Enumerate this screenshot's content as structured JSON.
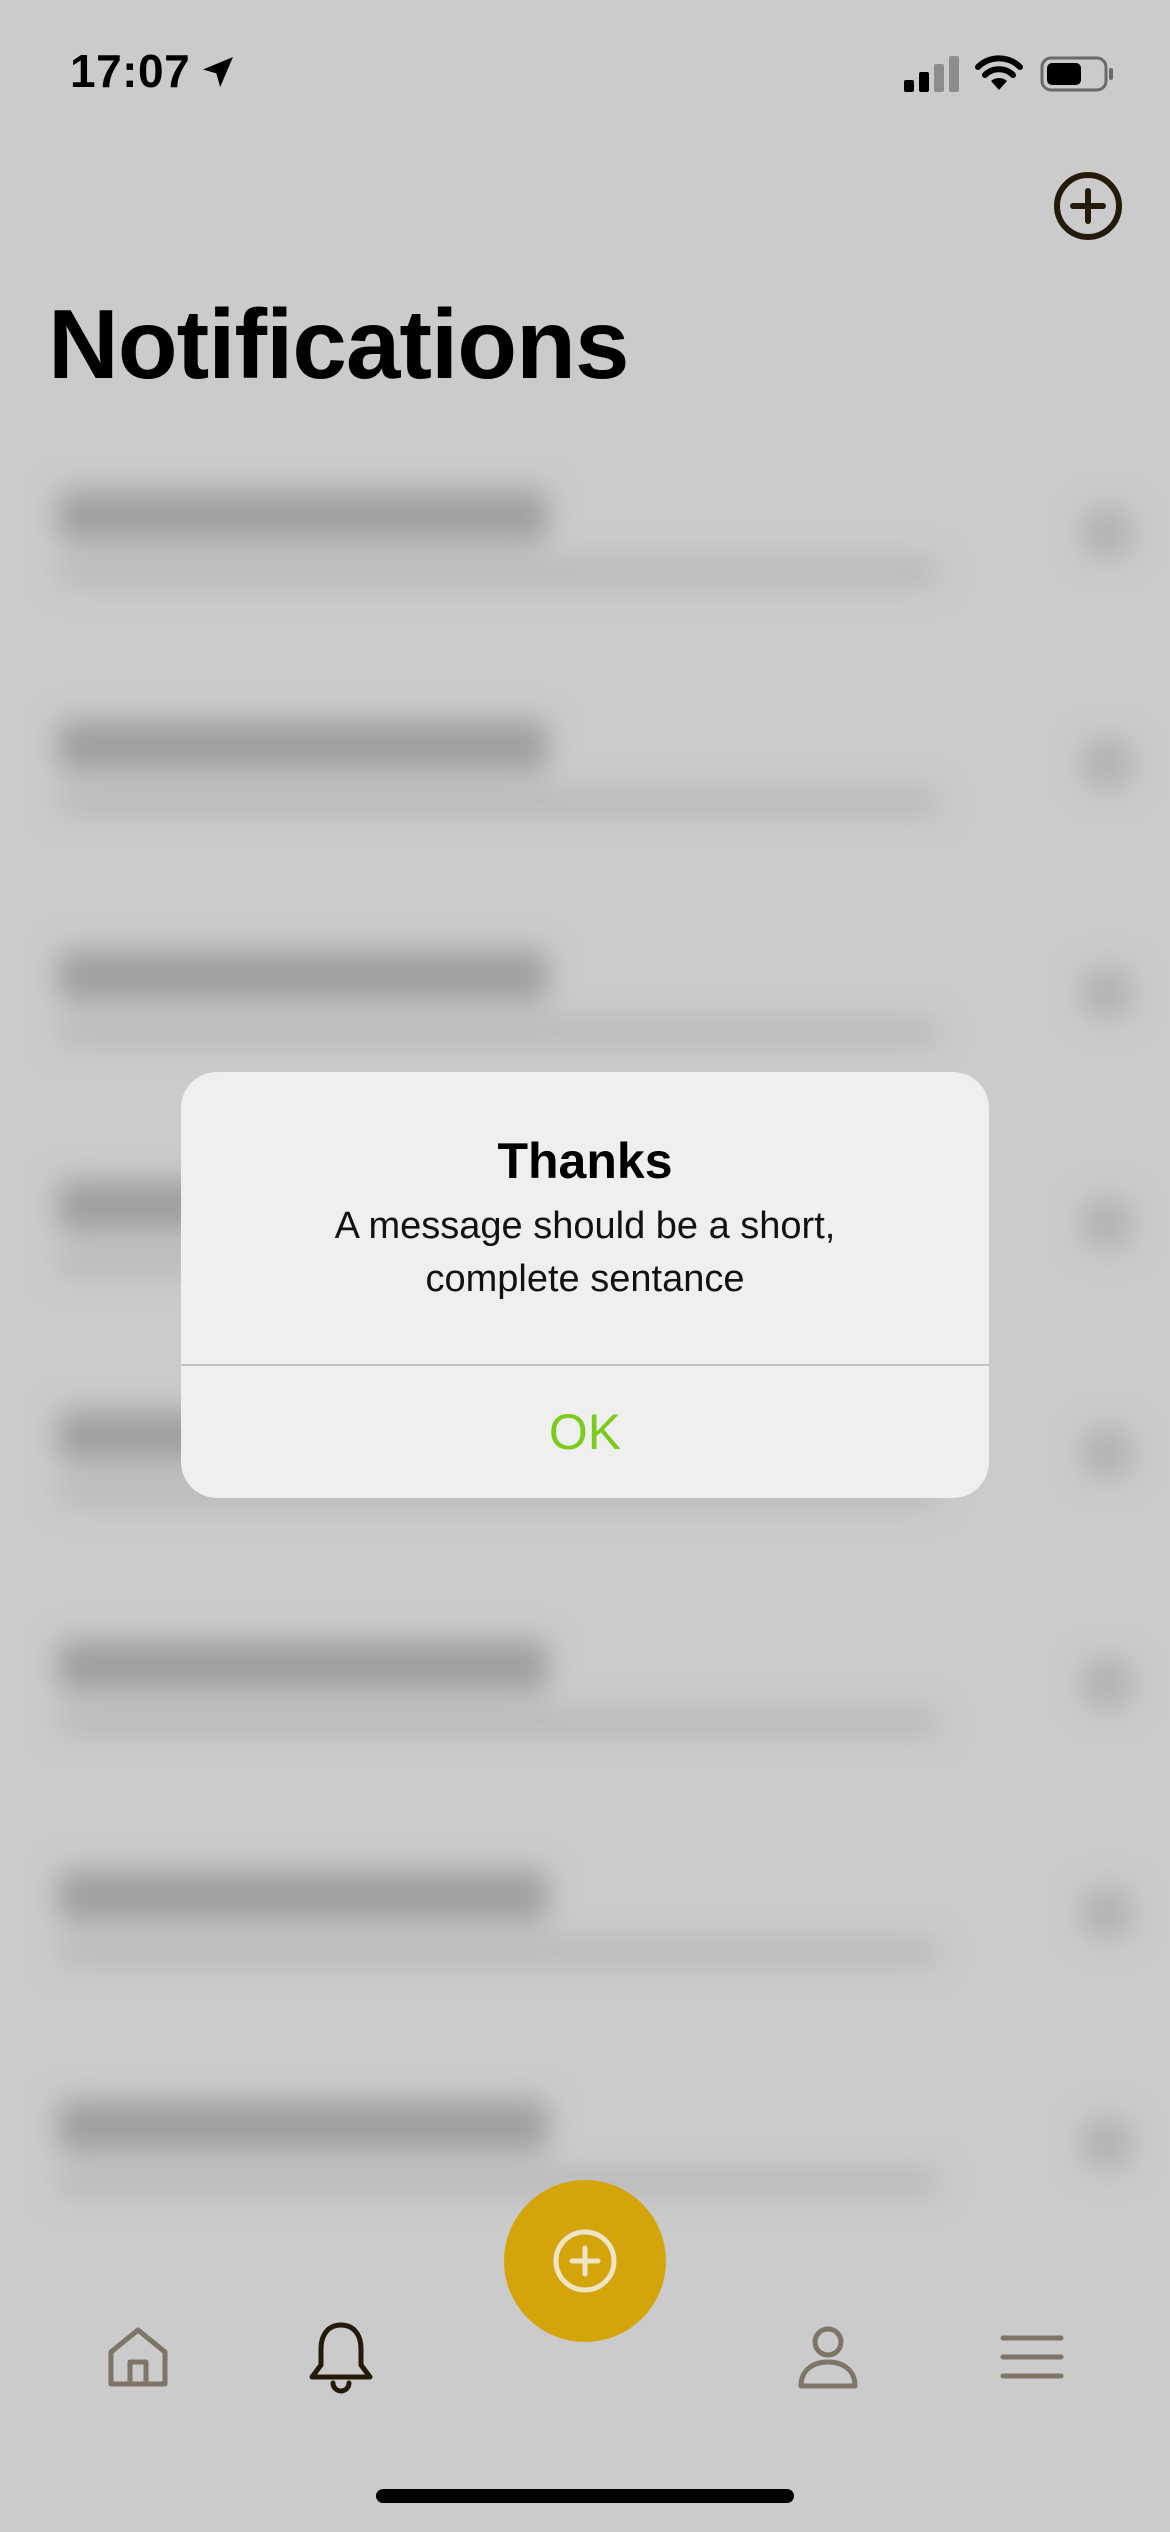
{
  "status_bar": {
    "time": "17:07",
    "icons": [
      "location-arrow-icon",
      "cellular-signal-icon",
      "wifi-icon",
      "battery-icon"
    ]
  },
  "header": {
    "title": "Notifications",
    "add_icon": "plus-circle-icon"
  },
  "notifications": {
    "blurred_row_count": 8
  },
  "alert": {
    "title": "Thanks",
    "message": "A message should be a short, complete sentance",
    "ok_label": "OK"
  },
  "tab_bar": {
    "items": [
      "home-icon",
      "bell-icon",
      "plus-circle-icon",
      "person-icon",
      "menu-icon"
    ],
    "active": "bell-icon"
  },
  "colors": {
    "background": "#cbcbcb",
    "accent": "#d4a50a",
    "alert_button": "#7ccb1c",
    "active_icon": "#241a0a",
    "inactive_icon": "#7d7567"
  }
}
